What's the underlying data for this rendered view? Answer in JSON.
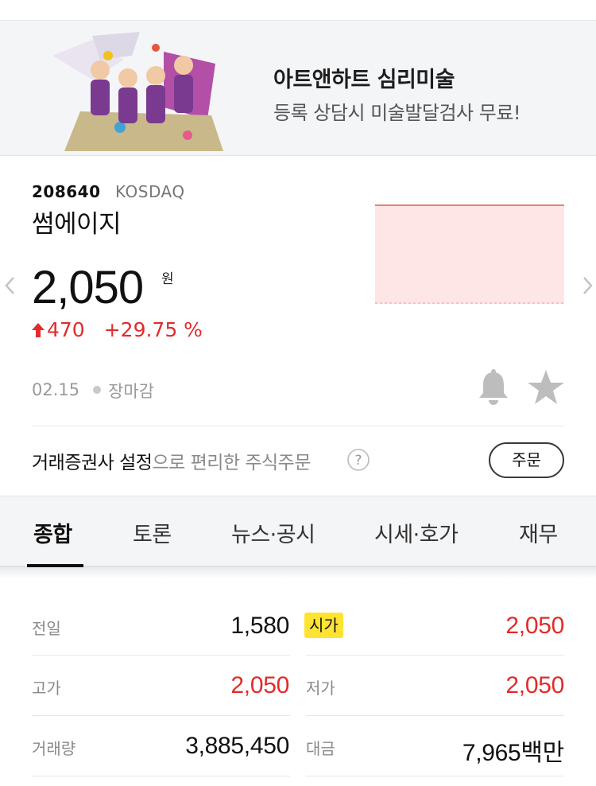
{
  "ad": {
    "title": "아트앤하트 심리미술",
    "subtitle": "등록 상담시 미술발달검사 무료!"
  },
  "stock": {
    "code": "208640",
    "market": "KOSDAQ",
    "name": "썸에이지",
    "price": "2,050",
    "unit": "원",
    "change": "470",
    "change_pct": "+29.75 %",
    "date": "02.15",
    "status": "장마감"
  },
  "promo": {
    "strong": "거래증권사 설정",
    "weak": "으로 편리한 주식주문",
    "order_label": "주문"
  },
  "tabs": [
    "종합",
    "토론",
    "뉴스·공시",
    "시세·호가",
    "재무"
  ],
  "summary": {
    "prev_close_label": "전일",
    "prev_close": "1,580",
    "open_label": "시가",
    "open": "2,050",
    "high_label": "고가",
    "high": "2,050",
    "low_label": "저가",
    "low": "2,050",
    "volume_label": "거래량",
    "volume": "3,885,450",
    "amount_label": "대금",
    "amount": "7,965백만"
  },
  "colors": {
    "up": "#e22b2b",
    "badge": "#ffe333",
    "chart_fill": "#ffe6e6"
  },
  "icons": [
    "chevron-left-icon",
    "chevron-right-icon",
    "up-arrow-icon",
    "bell-icon",
    "star-icon",
    "help-icon"
  ]
}
